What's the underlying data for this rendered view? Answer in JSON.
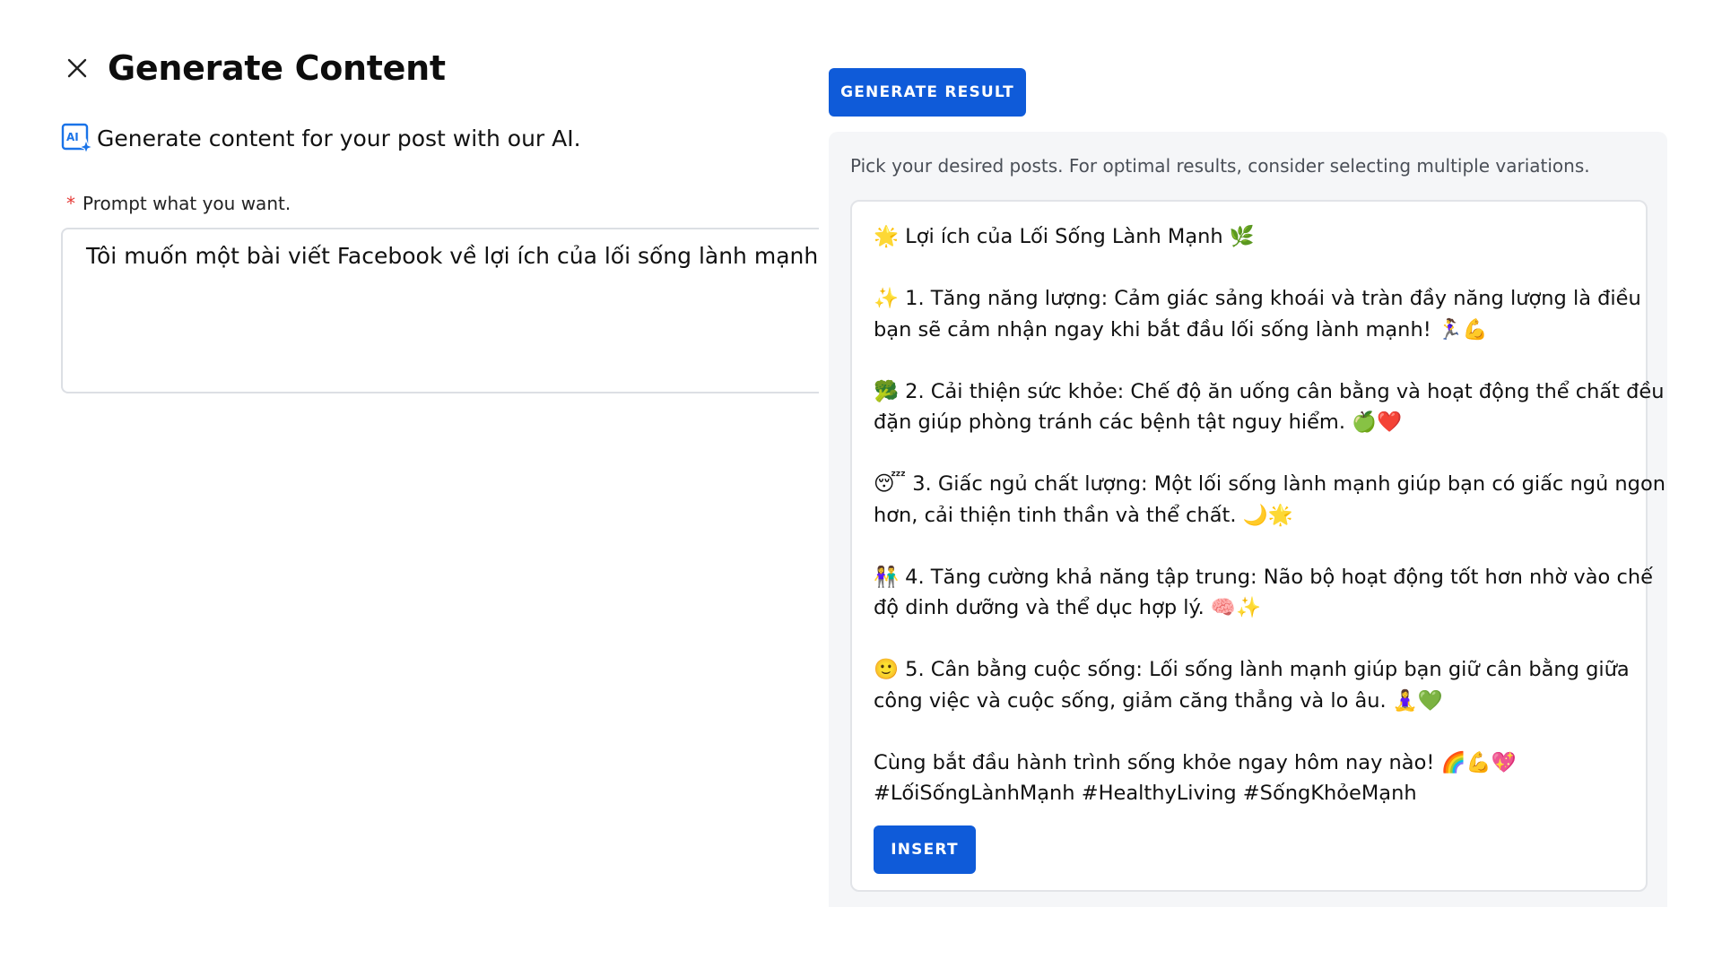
{
  "header": {
    "title": "Generate Content",
    "subtitle": "Generate content for your post with our AI."
  },
  "prompt": {
    "required_mark": "*",
    "label": "Prompt what you want.",
    "value": "Tôi muốn một bài viết Facebook về lợi ích của lối sống lành mạnh"
  },
  "actions": {
    "generate_label": "GENERATE RESULT",
    "insert_label": "INSERT"
  },
  "result": {
    "hint": "Pick your desired posts. For optimal results, consider selecting multiple variations.",
    "post": {
      "title": "🌟 Lợi ích của Lối Sống Lành Mạnh 🌿",
      "p1_line1": "✨ 1. Tăng năng lượng: Cảm giác sảng khoái và tràn đầy năng lượng là điều",
      "p1_line2": "bạn sẽ cảm nhận ngay khi bắt đầu lối sống lành mạnh! 🏃‍♀️💪",
      "p2_line1": "🥦 2. Cải thiện sức khỏe: Chế độ ăn uống cân bằng và hoạt động thể chất đều",
      "p2_line2": "đặn giúp phòng tránh các bệnh tật nguy hiểm. 🍏❤️",
      "p3_line1": "😴 3. Giấc ngủ chất lượng: Một lối sống lành mạnh giúp bạn có giấc ngủ ngon",
      "p3_line2": "hơn, cải thiện tinh thần và thể chất. 🌙🌟",
      "p4_line1": "👫 4. Tăng cường khả năng tập trung: Não bộ hoạt động tốt hơn nhờ vào chế",
      "p4_line2": "độ dinh dưỡng và thể dục hợp lý. 🧠✨",
      "p5_line1": "🙂 5. Cân bằng cuộc sống: Lối sống lành mạnh giúp bạn giữ cân bằng giữa",
      "p5_line2": "công việc và cuộc sống, giảm căng thẳng và lo âu. 🧘‍♀️💚",
      "closing": "Cùng bắt đầu hành trình sống khỏe ngay hôm nay nào! 🌈💪💖",
      "hashtags": "#LốiSốngLànhMạnh #HealthyLiving #SốngKhỏeMạnh"
    }
  },
  "icons": {
    "close": "close-icon",
    "ai": "ai-sparkle-icon"
  },
  "colors": {
    "primary": "#0f5bd9",
    "required": "#e53935",
    "panel_bg": "#f5f6f8"
  }
}
